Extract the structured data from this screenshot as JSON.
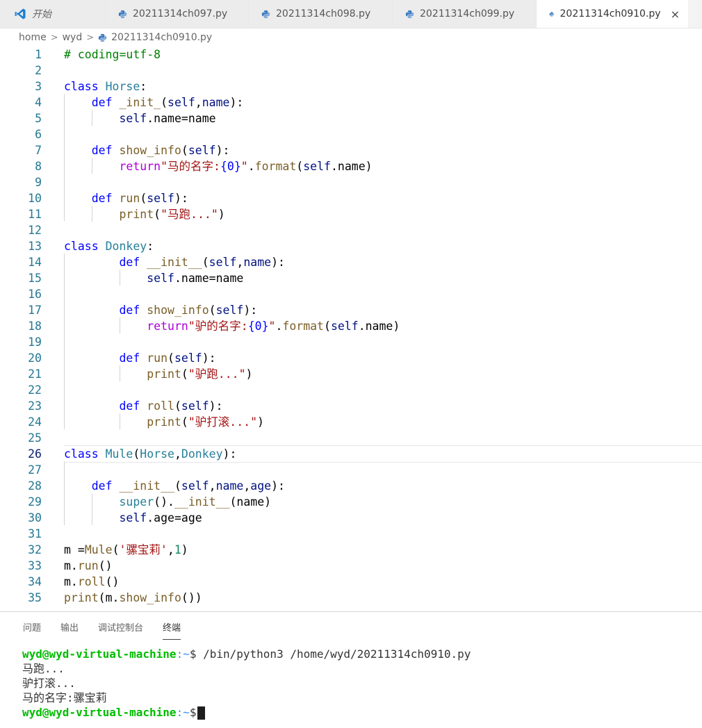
{
  "tabs": [
    {
      "label": "开始",
      "icon": "vscode-logo-icon",
      "active": false
    },
    {
      "label": "20211314ch097.py",
      "icon": "python-file-icon",
      "active": false
    },
    {
      "label": "20211314ch098.py",
      "icon": "python-file-icon",
      "active": false
    },
    {
      "label": "20211314ch099.py",
      "icon": "python-file-icon",
      "active": false
    },
    {
      "label": "20211314ch0910.py",
      "icon": "python-file-icon",
      "active": true,
      "close": "×"
    }
  ],
  "breadcrumb": {
    "items": [
      "home",
      "wyd",
      "20211314ch0910.py"
    ],
    "separator": ">"
  },
  "editor": {
    "current_line": 26,
    "lines": [
      {
        "n": "1",
        "t": [
          [
            "com",
            "# coding=utf-8"
          ]
        ]
      },
      {
        "n": "2",
        "t": []
      },
      {
        "n": "3",
        "t": [
          [
            "kw",
            "class"
          ],
          [
            "txt",
            " "
          ],
          [
            "cls",
            "Horse"
          ],
          [
            "txt",
            ":"
          ]
        ]
      },
      {
        "n": "4",
        "t": [
          [
            "txt",
            "    "
          ],
          [
            "kw",
            "def"
          ],
          [
            "txt",
            " "
          ],
          [
            "fn",
            "_init_"
          ],
          [
            "txt",
            "("
          ],
          [
            "prm",
            "self"
          ],
          [
            "txt",
            ","
          ],
          [
            "prm",
            "name"
          ],
          [
            "txt",
            "):"
          ]
        ]
      },
      {
        "n": "5",
        "t": [
          [
            "txt",
            "        "
          ],
          [
            "prm",
            "self"
          ],
          [
            "txt",
            ".name=name"
          ]
        ]
      },
      {
        "n": "6",
        "t": []
      },
      {
        "n": "7",
        "t": [
          [
            "txt",
            "    "
          ],
          [
            "kw",
            "def"
          ],
          [
            "txt",
            " "
          ],
          [
            "fn",
            "show_info"
          ],
          [
            "txt",
            "("
          ],
          [
            "prm",
            "self"
          ],
          [
            "txt",
            "):"
          ]
        ]
      },
      {
        "n": "8",
        "t": [
          [
            "txt",
            "        "
          ],
          [
            "ctl",
            "return"
          ],
          [
            "str",
            "\"马的名字:"
          ],
          [
            "kw",
            "{0}"
          ],
          [
            "str",
            "\""
          ],
          [
            "txt",
            "."
          ],
          [
            "fn",
            "format"
          ],
          [
            "txt",
            "("
          ],
          [
            "prm",
            "self"
          ],
          [
            "txt",
            ".name)"
          ]
        ]
      },
      {
        "n": "9",
        "t": []
      },
      {
        "n": "10",
        "t": [
          [
            "txt",
            "    "
          ],
          [
            "kw",
            "def"
          ],
          [
            "txt",
            " "
          ],
          [
            "fn",
            "run"
          ],
          [
            "txt",
            "("
          ],
          [
            "prm",
            "self"
          ],
          [
            "txt",
            "):"
          ]
        ]
      },
      {
        "n": "11",
        "t": [
          [
            "txt",
            "        "
          ],
          [
            "fn",
            "print"
          ],
          [
            "txt",
            "("
          ],
          [
            "str",
            "\"马跑...\""
          ],
          [
            "txt",
            ")"
          ]
        ]
      },
      {
        "n": "12",
        "t": []
      },
      {
        "n": "13",
        "t": [
          [
            "kw",
            "class"
          ],
          [
            "txt",
            " "
          ],
          [
            "cls",
            "Donkey"
          ],
          [
            "txt",
            ":"
          ]
        ]
      },
      {
        "n": "14",
        "t": [
          [
            "txt",
            "        "
          ],
          [
            "kw",
            "def"
          ],
          [
            "txt",
            " "
          ],
          [
            "fn",
            "__init__"
          ],
          [
            "txt",
            "("
          ],
          [
            "prm",
            "self"
          ],
          [
            "txt",
            ","
          ],
          [
            "prm",
            "name"
          ],
          [
            "txt",
            "):"
          ]
        ]
      },
      {
        "n": "15",
        "t": [
          [
            "txt",
            "            "
          ],
          [
            "prm",
            "self"
          ],
          [
            "txt",
            ".name=name"
          ]
        ]
      },
      {
        "n": "16",
        "t": []
      },
      {
        "n": "17",
        "t": [
          [
            "txt",
            "        "
          ],
          [
            "kw",
            "def"
          ],
          [
            "txt",
            " "
          ],
          [
            "fn",
            "show_info"
          ],
          [
            "txt",
            "("
          ],
          [
            "prm",
            "self"
          ],
          [
            "txt",
            "):"
          ]
        ]
      },
      {
        "n": "18",
        "t": [
          [
            "txt",
            "            "
          ],
          [
            "ctl",
            "return"
          ],
          [
            "str",
            "\"驴的名字:"
          ],
          [
            "kw",
            "{0}"
          ],
          [
            "str",
            "\""
          ],
          [
            "txt",
            "."
          ],
          [
            "fn",
            "format"
          ],
          [
            "txt",
            "("
          ],
          [
            "prm",
            "self"
          ],
          [
            "txt",
            ".name)"
          ]
        ]
      },
      {
        "n": "19",
        "t": []
      },
      {
        "n": "20",
        "t": [
          [
            "txt",
            "        "
          ],
          [
            "kw",
            "def"
          ],
          [
            "txt",
            " "
          ],
          [
            "fn",
            "run"
          ],
          [
            "txt",
            "("
          ],
          [
            "prm",
            "self"
          ],
          [
            "txt",
            "):"
          ]
        ]
      },
      {
        "n": "21",
        "t": [
          [
            "txt",
            "            "
          ],
          [
            "fn",
            "print"
          ],
          [
            "txt",
            "("
          ],
          [
            "str",
            "\"驴跑...\""
          ],
          [
            "txt",
            ")"
          ]
        ]
      },
      {
        "n": "22",
        "t": []
      },
      {
        "n": "23",
        "t": [
          [
            "txt",
            "        "
          ],
          [
            "kw",
            "def"
          ],
          [
            "txt",
            " "
          ],
          [
            "fn",
            "roll"
          ],
          [
            "txt",
            "("
          ],
          [
            "prm",
            "self"
          ],
          [
            "txt",
            "):"
          ]
        ]
      },
      {
        "n": "24",
        "t": [
          [
            "txt",
            "            "
          ],
          [
            "fn",
            "print"
          ],
          [
            "txt",
            "("
          ],
          [
            "str",
            "\"驴打滚...\""
          ],
          [
            "txt",
            ")"
          ]
        ]
      },
      {
        "n": "25",
        "t": []
      },
      {
        "n": "26",
        "t": [
          [
            "kw",
            "class"
          ],
          [
            "txt",
            " "
          ],
          [
            "cls",
            "Mule"
          ],
          [
            "txt",
            "("
          ],
          [
            "cls",
            "Horse"
          ],
          [
            "txt",
            ","
          ],
          [
            "cls",
            "Donkey"
          ],
          [
            "txt",
            "):"
          ]
        ]
      },
      {
        "n": "27",
        "t": []
      },
      {
        "n": "28",
        "t": [
          [
            "txt",
            "    "
          ],
          [
            "kw",
            "def"
          ],
          [
            "txt",
            " "
          ],
          [
            "fn",
            "__init__"
          ],
          [
            "txt",
            "("
          ],
          [
            "prm",
            "self"
          ],
          [
            "txt",
            ","
          ],
          [
            "prm",
            "name"
          ],
          [
            "txt",
            ","
          ],
          [
            "prm",
            "age"
          ],
          [
            "txt",
            "):"
          ]
        ]
      },
      {
        "n": "29",
        "t": [
          [
            "txt",
            "        "
          ],
          [
            "cls",
            "super"
          ],
          [
            "txt",
            "()."
          ],
          [
            "fn",
            "__init__"
          ],
          [
            "txt",
            "(name)"
          ]
        ]
      },
      {
        "n": "30",
        "t": [
          [
            "txt",
            "        "
          ],
          [
            "prm",
            "self"
          ],
          [
            "txt",
            ".age=age"
          ]
        ]
      },
      {
        "n": "31",
        "t": []
      },
      {
        "n": "32",
        "t": [
          [
            "txt",
            "m ="
          ],
          [
            "fn",
            "Mule"
          ],
          [
            "txt",
            "("
          ],
          [
            "str",
            "'骡宝莉'"
          ],
          [
            "txt",
            ","
          ],
          [
            "num",
            "1"
          ],
          [
            "txt",
            ")"
          ]
        ]
      },
      {
        "n": "33",
        "t": [
          [
            "txt",
            "m."
          ],
          [
            "fn",
            "run"
          ],
          [
            "txt",
            "()"
          ]
        ]
      },
      {
        "n": "34",
        "t": [
          [
            "txt",
            "m."
          ],
          [
            "fn",
            "roll"
          ],
          [
            "txt",
            "()"
          ]
        ]
      },
      {
        "n": "35",
        "t": [
          [
            "fn",
            "print"
          ],
          [
            "txt",
            "(m."
          ],
          [
            "fn",
            "show_info"
          ],
          [
            "txt",
            "())"
          ]
        ]
      }
    ]
  },
  "panel": {
    "tabs": [
      "问题",
      "输出",
      "调试控制台",
      "终端"
    ],
    "active_tab": "终端"
  },
  "terminal": {
    "prompt_user": "wyd@wyd-virtual-machine",
    "prompt_path": ":~",
    "prompt_symbol": "$",
    "command": " /bin/python3 /home/wyd/20211314ch0910.py",
    "output": [
      "马跑...",
      "驴打滚...",
      "马的名字:骡宝莉"
    ]
  },
  "colors": {
    "keyword": "#0000ff",
    "function": "#795e26",
    "class": "#267f99",
    "parameter": "#001080",
    "string": "#a31515",
    "control": "#af00db",
    "comment": "#008000",
    "line_number": "#237893",
    "prompt_user": "#00bc00"
  }
}
